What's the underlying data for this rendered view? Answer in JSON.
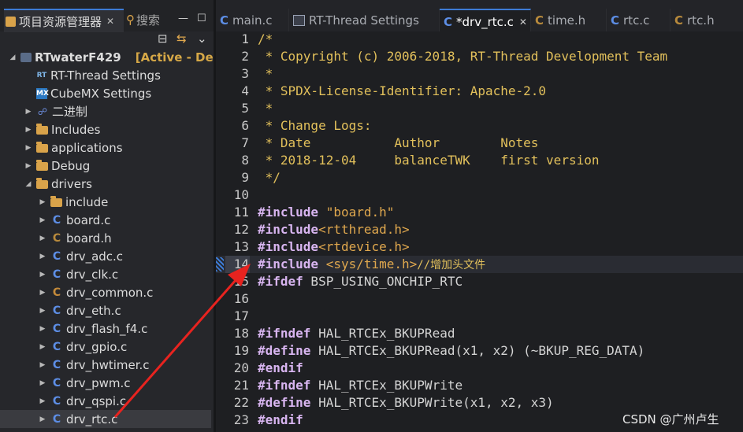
{
  "left_panel": {
    "tab_project": "项目资源管理器",
    "tab_search": "搜索",
    "close_glyph": "✕",
    "minimize_glyph": "—",
    "maximize_glyph": "☐",
    "toolbar_collapse": "⊟",
    "toolbar_link": "⇆",
    "toolbar_menu": "⌄"
  },
  "tree": {
    "project_name": "RTwaterF429",
    "project_status": "[Active - Debu",
    "items": [
      {
        "label": "RT-Thread Settings"
      },
      {
        "label": "CubeMX Settings"
      },
      {
        "label": "二进制"
      },
      {
        "label": "Includes"
      },
      {
        "label": "applications"
      },
      {
        "label": "Debug"
      },
      {
        "label": "drivers"
      },
      {
        "label": "include"
      },
      {
        "label": "board.c"
      },
      {
        "label": "board.h"
      },
      {
        "label": "drv_adc.c"
      },
      {
        "label": "drv_clk.c"
      },
      {
        "label": "drv_common.c"
      },
      {
        "label": "drv_eth.c"
      },
      {
        "label": "drv_flash_f4.c"
      },
      {
        "label": "drv_gpio.c"
      },
      {
        "label": "drv_hwtimer.c"
      },
      {
        "label": "drv_pwm.c"
      },
      {
        "label": "drv_qspi.c"
      },
      {
        "label": "drv_rtc.c"
      }
    ],
    "icon_rt": "RT",
    "icon_mx": "MX",
    "icon_c": "C"
  },
  "editor_tabs": [
    {
      "label": "main.c"
    },
    {
      "label": "RT-Thread Settings"
    },
    {
      "label": "*drv_rtc.c"
    },
    {
      "label": "time.h"
    },
    {
      "label": "rtc.c"
    },
    {
      "label": "rtc.h"
    }
  ],
  "code": {
    "line_numbers": [
      "1",
      "2",
      "3",
      "4",
      "5",
      "6",
      "7",
      "8",
      "9",
      "10",
      "11",
      "12",
      "13",
      "14",
      "15",
      "16",
      "17",
      "18",
      "19",
      "20",
      "21",
      "22",
      "23"
    ],
    "l1": "/*",
    "l2": " * Copyright (c) 2006-2018, RT-Thread Development Team",
    "l3": " *",
    "l4": " * SPDX-License-Identifier: Apache-2.0",
    "l5": " *",
    "l6": " * Change Logs:",
    "l7": " * Date           Author        Notes",
    "l8": " * 2018-12-04     balanceTWK    first version",
    "l9": " */",
    "inc_kw": "#include",
    "l11_arg": " \"board.h\"",
    "l12_arg": "<rtthread.h>",
    "l13_arg": "<rtdevice.h>",
    "l14_arg": " <sys/time.h>",
    "l14_comment": "//增加头文件",
    "ifdef_kw": "#ifdef",
    "l15_rest": " BSP_USING_ONCHIP_RTC",
    "ifndef_kw": "#ifndef",
    "define_kw": "#define",
    "endif_kw": "#endif",
    "l18_rest": " HAL_RTCEx_BKUPRead",
    "l19_rest": " HAL_RTCEx_BKUPRead(x1, x2) (~BKUP_REG_DATA)",
    "l21_rest": " HAL_RTCEx_BKUPWrite",
    "l22_rest": " HAL_RTCEx_BKUPWrite(x1, x2, x3)"
  },
  "watermark": "CSDN @广州卢生",
  "colors": {
    "accent": "#3d7bd5",
    "arrow": "#e8231f"
  }
}
